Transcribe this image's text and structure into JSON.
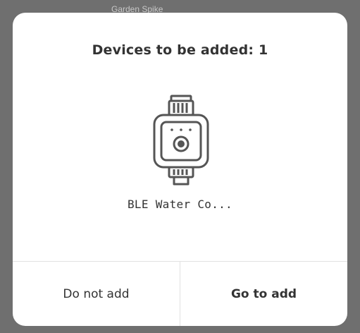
{
  "background": {
    "peek_label": "Garden Spike"
  },
  "dialog": {
    "title": "Devices to be added: 1",
    "device": {
      "name": "BLE Water Co...",
      "icon": "water-controller-icon"
    },
    "buttons": {
      "cancel_label": "Do not add",
      "confirm_label": "Go to add"
    }
  },
  "colors": {
    "overlay": "#6f6f6f",
    "dialog_bg": "#ffffff",
    "text": "#333333",
    "icon_stroke": "#555555",
    "divider": "#e2e2e2"
  }
}
